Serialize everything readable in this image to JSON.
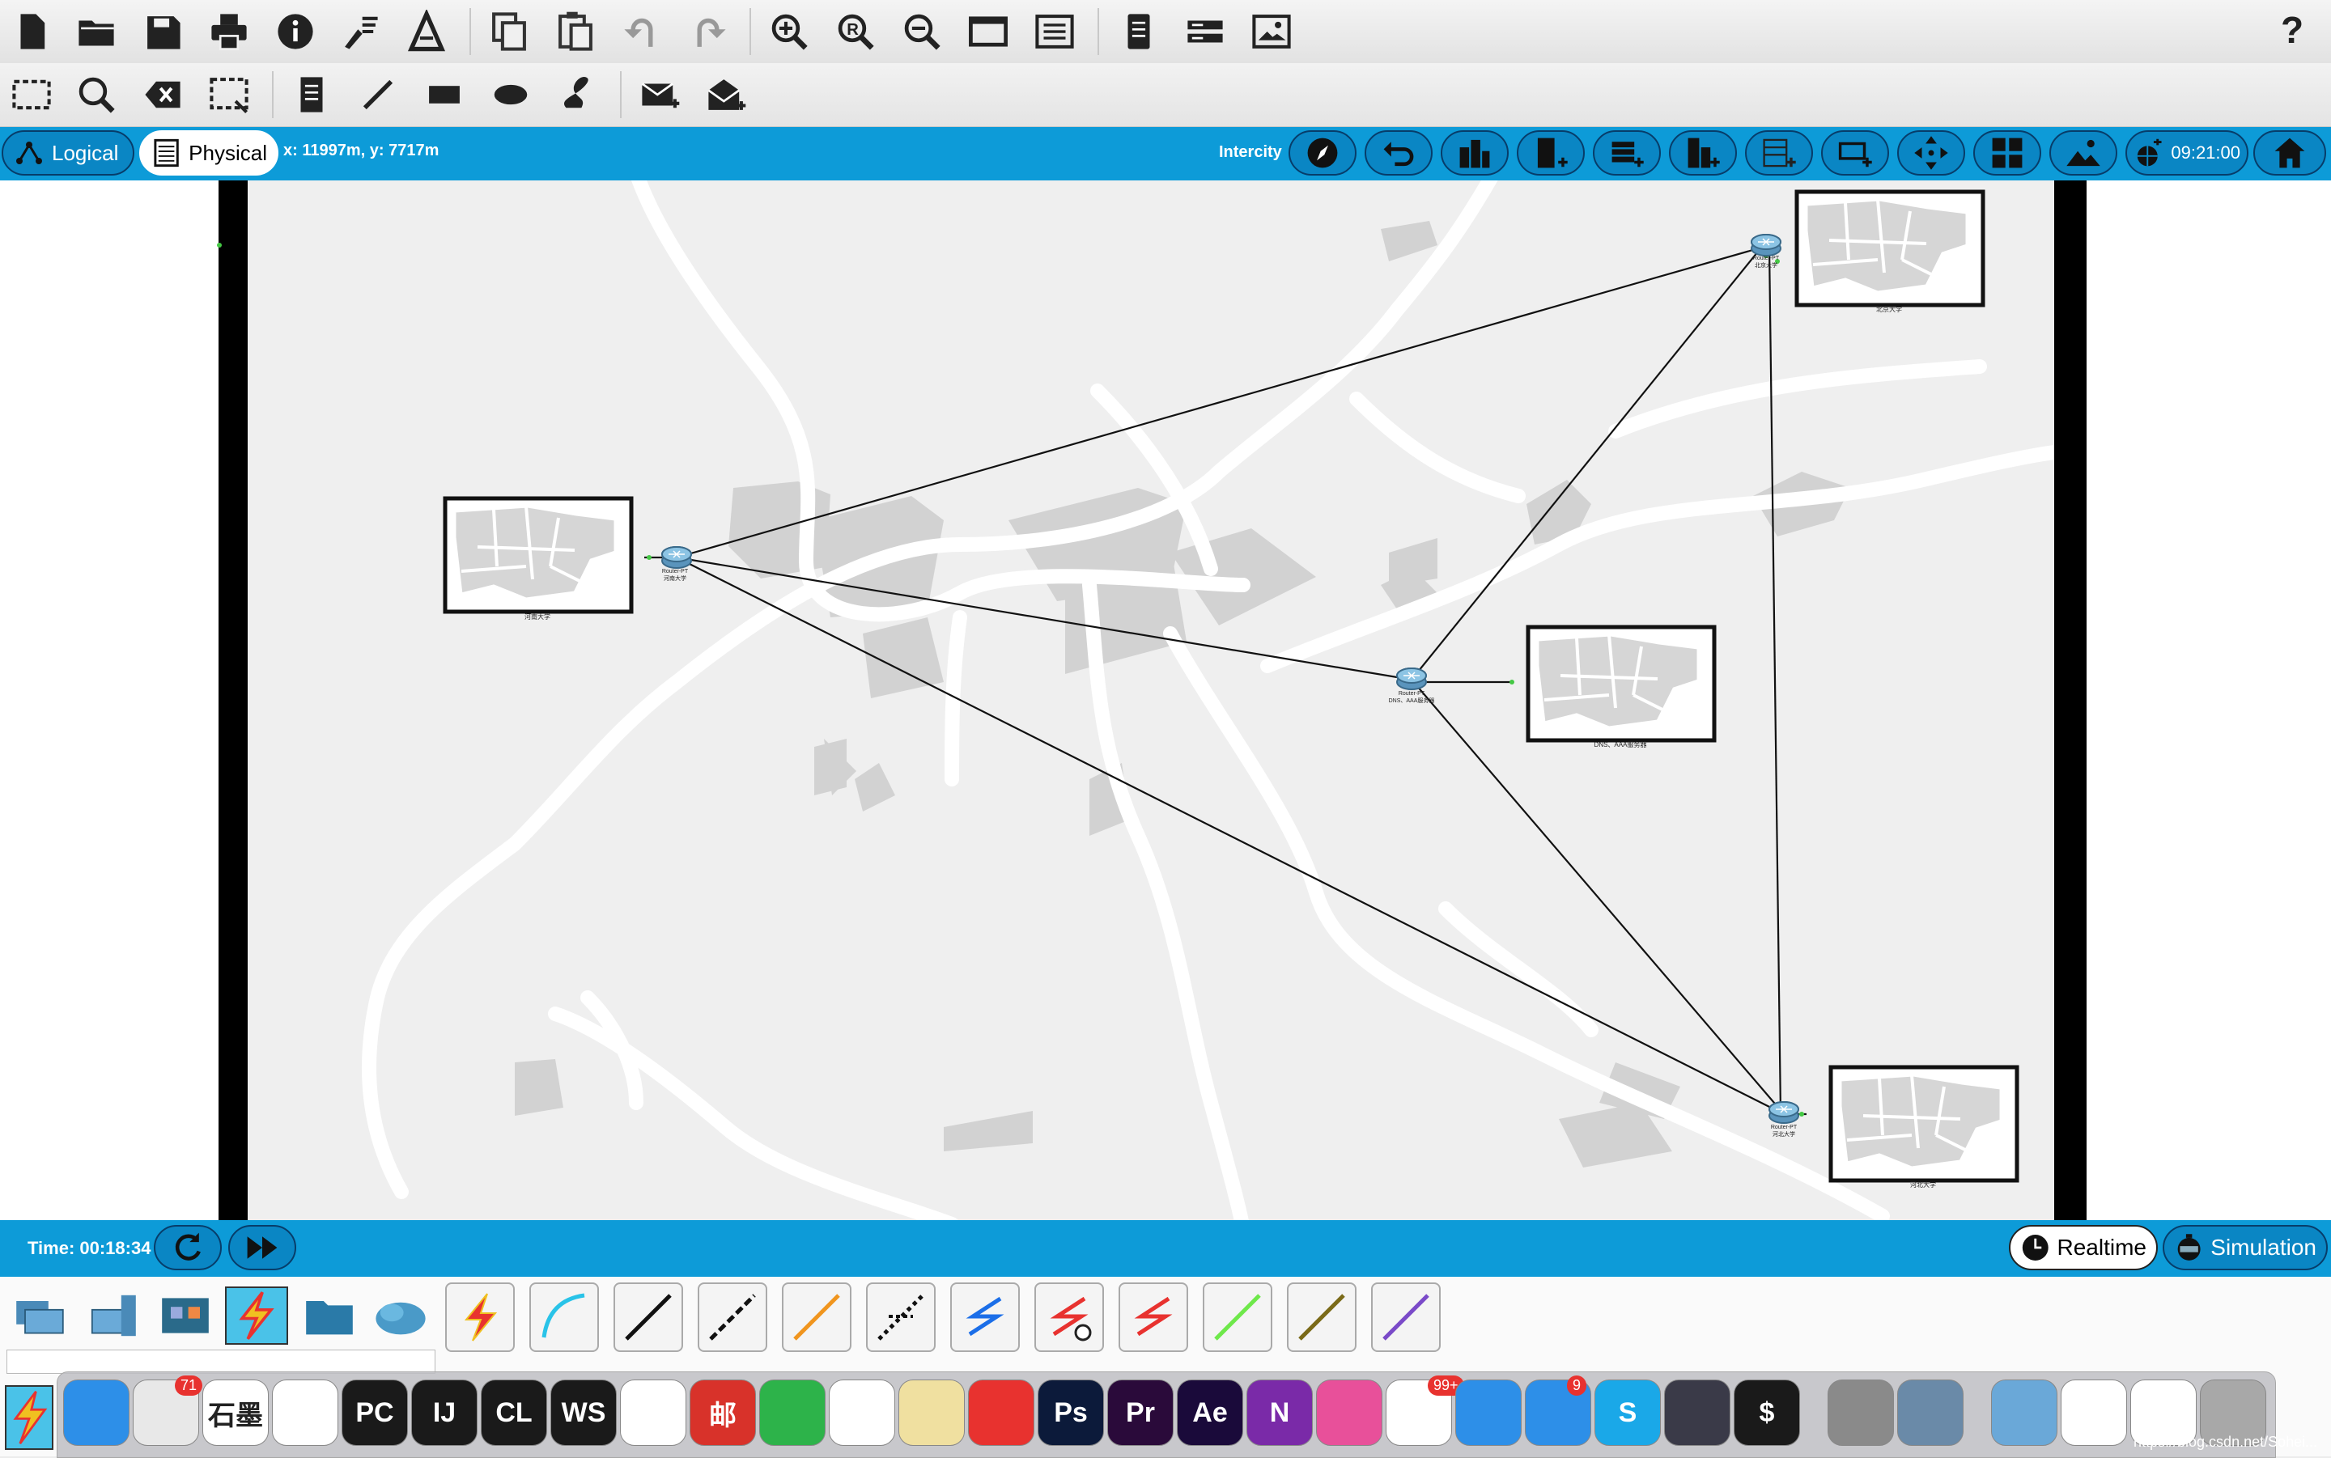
{
  "top_toolbar": {
    "icons": [
      "new-file-icon",
      "open-folder-icon",
      "save-icon",
      "print-icon",
      "info-icon",
      "activity-wizard-icon",
      "network-info-icon",
      "copy-icon",
      "paste-icon",
      "undo-icon",
      "redo-icon",
      "zoom-in-icon",
      "zoom-reset-icon",
      "zoom-out-icon",
      "drawing-palette-icon",
      "custom-devices-icon",
      "cluster-icon",
      "pdu-icon",
      "screenshot-icon"
    ],
    "help_label": "?"
  },
  "secondary_toolbar": {
    "icons": [
      "select-icon",
      "inspect-icon",
      "delete-icon",
      "resize-icon",
      "note-icon",
      "line-icon",
      "rectangle-icon",
      "ellipse-icon",
      "freeform-icon",
      "add-simple-pdu-icon",
      "add-complex-pdu-icon"
    ]
  },
  "navbar": {
    "logical_label": "Logical",
    "physical_label": "Physical",
    "coords": "x: 11997m, y: 7717m",
    "location_label": "Intercity",
    "clock": "09:21:00",
    "colors": {
      "bar": "#0d9bd8",
      "button": "#0a86c4"
    }
  },
  "map": {
    "routers": [
      {
        "id": "r-west",
        "label": "Router-PT",
        "sublabel": "河南大学"
      },
      {
        "id": "r-center",
        "label": "Router-PT",
        "sublabel": "DNS、AAA服务器"
      },
      {
        "id": "r-north",
        "label": "Router-PT",
        "sublabel": "北京大学"
      },
      {
        "id": "r-south",
        "label": "Router-PT",
        "sublabel": "河北大学"
      }
    ],
    "buildings": [
      {
        "id": "b-west",
        "label": "河南大学"
      },
      {
        "id": "b-center",
        "label": "DNS、AAA服务器"
      },
      {
        "id": "b-north",
        "label": "北京大学"
      },
      {
        "id": "b-south",
        "label": "河北大学"
      }
    ]
  },
  "timebar": {
    "time_label": "Time: 00:18:34",
    "realtime_label": "Realtime",
    "simulation_label": "Simulation"
  },
  "palette": {
    "device_categories": [
      "network-devices-icon",
      "end-devices-icon",
      "components-icon",
      "connections-icon",
      "misc-icon",
      "multiuser-icon"
    ],
    "connection_types": [
      {
        "name": "automatic-connection",
        "color": "#e8322f"
      },
      {
        "name": "console",
        "color": "#29c3e8"
      },
      {
        "name": "copper-straight-through",
        "color": "#111111"
      },
      {
        "name": "copper-cross-over",
        "color": "#111111"
      },
      {
        "name": "fiber",
        "color": "#f0951e"
      },
      {
        "name": "phone",
        "color": "#111111"
      },
      {
        "name": "coaxial",
        "color": "#1b6ee8"
      },
      {
        "name": "serial-dce",
        "color": "#e8322f"
      },
      {
        "name": "serial-dte",
        "color": "#e8322f"
      },
      {
        "name": "octal",
        "color": "#6ee84a"
      },
      {
        "name": "iot-custom",
        "color": "#7a6a18"
      },
      {
        "name": "usb",
        "color": "#7a4ac8"
      }
    ]
  },
  "dock": {
    "apps": [
      {
        "name": "finder",
        "label": "",
        "color": "#2d8fe8"
      },
      {
        "name": "app-store-qq-browser",
        "label": "",
        "color": "#e8e8e8",
        "badge": "71"
      },
      {
        "name": "shimo",
        "label": "石墨",
        "color": "#ffffff"
      },
      {
        "name": "tasks",
        "label": "",
        "color": "#ffffff"
      },
      {
        "name": "pycharm",
        "label": "PC",
        "color": "#1a1a1a"
      },
      {
        "name": "intellij",
        "label": "IJ",
        "color": "#1a1a1a"
      },
      {
        "name": "clion",
        "label": "CL",
        "color": "#1a1a1a"
      },
      {
        "name": "webstorm",
        "label": "WS",
        "color": "#1a1a1a"
      },
      {
        "name": "chrome",
        "label": "",
        "color": "#ffffff"
      },
      {
        "name": "mail-cn",
        "label": "邮",
        "color": "#d8322a"
      },
      {
        "name": "evernote",
        "label": "",
        "color": "#2db34a"
      },
      {
        "name": "wechat",
        "label": "",
        "color": "#ffffff"
      },
      {
        "name": "preview-scan",
        "label": "",
        "color": "#f0e0a0"
      },
      {
        "name": "parallels",
        "label": "",
        "color": "#e8322f"
      },
      {
        "name": "photoshop",
        "label": "Ps",
        "color": "#0c1a3a"
      },
      {
        "name": "premiere",
        "label": "Pr",
        "color": "#2a0a3a"
      },
      {
        "name": "after-effects",
        "label": "Ae",
        "color": "#1a0a3a"
      },
      {
        "name": "onenote",
        "label": "N",
        "color": "#7a2aa8"
      },
      {
        "name": "cleanmymac",
        "label": "",
        "color": "#e8509a"
      },
      {
        "name": "qq",
        "label": "",
        "color": "#ffffff",
        "badge": "99+"
      },
      {
        "name": "safari",
        "label": "",
        "color": "#2d8fe8"
      },
      {
        "name": "app-store",
        "label": "",
        "color": "#2d8fe8",
        "badge": "9"
      },
      {
        "name": "skype",
        "label": "S",
        "color": "#1aa8e8"
      },
      {
        "name": "launchpad",
        "label": "",
        "color": "#3a3a48"
      },
      {
        "name": "terminal",
        "label": "$",
        "color": "#1a1a1a"
      },
      {
        "name": "system-preferences",
        "label": "",
        "color": "#8a8a8a"
      },
      {
        "name": "image-capture",
        "label": "",
        "color": "#6a8aa8"
      },
      {
        "name": "downloads-folder",
        "label": "",
        "color": "#6aa8d8"
      },
      {
        "name": "recent-doc",
        "label": "",
        "color": "#ffffff"
      },
      {
        "name": "recent-screenshot",
        "label": "",
        "color": "#ffffff"
      },
      {
        "name": "trash",
        "label": "",
        "color": "#a8a8a8"
      }
    ],
    "watermark": "https://blog.csdn.net/Sohei..."
  }
}
